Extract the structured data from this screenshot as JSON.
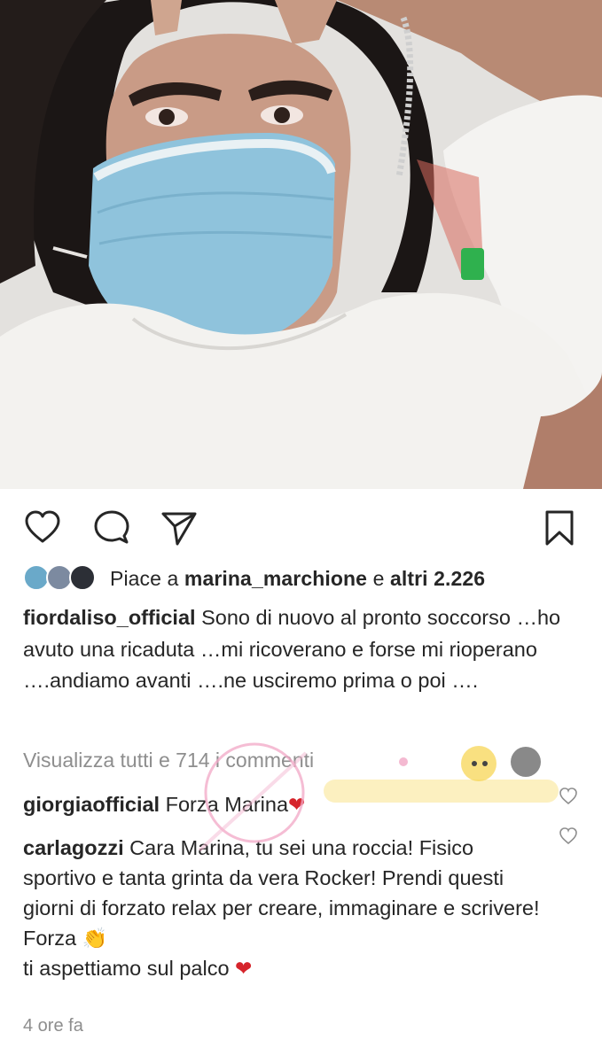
{
  "post": {
    "likes": {
      "prefix": "Piace a",
      "user": "marina_marchione",
      "middle": "e",
      "others": "altri 2.226"
    },
    "caption": {
      "username": "fiordaliso_official",
      "text": "Sono di nuovo al pronto soccorso …ho avuto una ricaduta …mi ricoverano e forse mi rioperano ….andiamo avanti ….ne usciremo prima o poi …."
    },
    "view_all_comments": "Visualizza tutti e 714 i commenti",
    "comments": [
      {
        "username": "giorgiaofficial",
        "text": "Forza Marina",
        "emoji": "❤"
      },
      {
        "username": "carlagozzi",
        "text": "Cara Marina, tu sei una roccia! Fisico sportivo e tanta grinta da vera Rocker! Prendi questi giorni di forzato relax per creare, immaginare e scrivere! Forza",
        "emoji1": "👏",
        "text2": "ti aspettiamo sul palco",
        "emoji2": "❤"
      }
    ],
    "timestamp": "4 ore fa"
  },
  "icons": {
    "like": "heart-icon",
    "comment": "comment-bubble-icon",
    "share": "paper-plane-icon",
    "save": "bookmark-icon",
    "comment_like": "small-heart-icon"
  },
  "colors": {
    "text": "#262626",
    "secondary": "#8e8e8e",
    "heart": "#d6242b"
  }
}
